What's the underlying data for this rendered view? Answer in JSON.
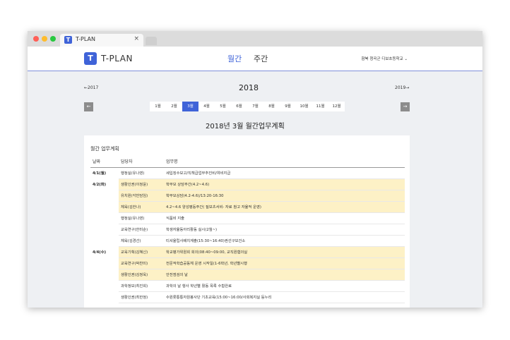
{
  "browser": {
    "tab_title": "T-PLAN",
    "tab_close": "×",
    "tab_icon": "T"
  },
  "header": {
    "logo_mark": "T",
    "logo_text": "T-PLAN",
    "nav_monthly": "월간",
    "nav_weekly": "주간",
    "school_selector": "함북 청곡군 디보초등학교 ⌄"
  },
  "calendar": {
    "prev_year": "←2017",
    "year": "2018",
    "next_year": "2019→",
    "prev_arrow": "←",
    "next_arrow": "→",
    "months": [
      "1월",
      "2월",
      "3월",
      "4월",
      "5월",
      "6월",
      "7월",
      "8월",
      "9월",
      "10월",
      "11월",
      "12월"
    ],
    "selected_month": "3월",
    "plan_title": "2018년 3월 월간업무계획"
  },
  "table": {
    "heading": "월간 업무계획",
    "columns": [
      "날짜",
      "담당자",
      "업무명"
    ],
    "rows": [
      {
        "date": "4/1(월)",
        "person": "행정실(유나영)",
        "task": "세입징수보고/직책급업무추진비/여비지급",
        "highlight": false
      },
      {
        "date": "4/2(화)",
        "person": "생활인권(이정윤)",
        "task": "학부모 상담주간(4.2~4.6)",
        "highlight": true
      },
      {
        "date": "",
        "person": "유치원(각반담임)",
        "task": "학부모상담(4.2-4.6)/13:20-16:30",
        "highlight": true
      },
      {
        "date": "",
        "person": "체육(김한나)",
        "task": "4.2~4.6 양성평등주간( 질보츠서비- 자료 참고 자율적 운영)",
        "highlight": true
      },
      {
        "date": "",
        "person": "행정실(유나영)",
        "task": "식품비 지출",
        "highlight": false
      },
      {
        "date": "",
        "person": "교육연구(한미순)",
        "task": "학생자율동아리활동 실시(2월~)",
        "highlight": false
      },
      {
        "date": "",
        "person": "체육(김경선)",
        "task": "티셔울립사배치계출(15:30~16:40)권선구보건소",
        "highlight": false
      },
      {
        "date": "4/4(수)",
        "person": "교육기획(김혜신)",
        "task": "학교평가위원회 회의(08:40~09:00, 교직원협의실",
        "highlight": true
      },
      {
        "date": "",
        "person": "교육연구(박찬미)",
        "task": "전문적학습공동체 운영 시작일(1-6학년, 학년별시행",
        "highlight": true
      },
      {
        "date": "",
        "person": "생활인권(김정욱)",
        "task": "안전점검의 날",
        "highlight": true
      },
      {
        "date": "",
        "person": "과학정보(최진희)",
        "task": "과학의 날 행사 학년별 활동 목록 수합완료",
        "highlight": false
      },
      {
        "date": "",
        "person": "생활인권(최한정)",
        "task": "수원롯통통자원봉사단 기초교육(15:00~16:00/사회복지실 등누리",
        "highlight": false
      }
    ]
  },
  "colors": {
    "accent": "#3f63d8",
    "highlight": "#fdf1c6",
    "background": "#eef0f3"
  }
}
